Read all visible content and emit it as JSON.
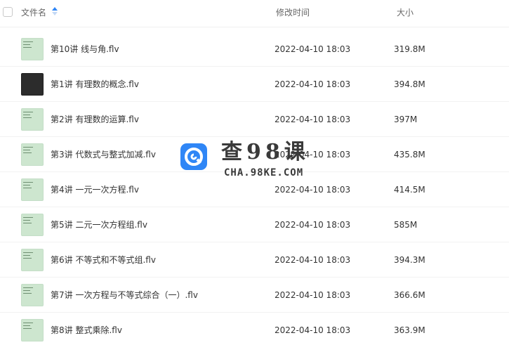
{
  "header": {
    "name_label": "文件名",
    "time_label": "修改时间",
    "size_label": "大小"
  },
  "files": [
    {
      "name": "第10讲 线与角.flv",
      "modified": "2022-04-10 18:03",
      "size": "319.8M",
      "thumb": "light"
    },
    {
      "name": "第1讲 有理数的概念.flv",
      "modified": "2022-04-10 18:03",
      "size": "394.8M",
      "thumb": "dark"
    },
    {
      "name": "第2讲 有理数的运算.flv",
      "modified": "2022-04-10 18:03",
      "size": "397M",
      "thumb": "light"
    },
    {
      "name": "第3讲 代数式与整式加减.flv",
      "modified": "2022-04-10 18:03",
      "size": "435.8M",
      "thumb": "light"
    },
    {
      "name": "第4讲 一元一次方程.flv",
      "modified": "2022-04-10 18:03",
      "size": "414.5M",
      "thumb": "light"
    },
    {
      "name": "第5讲 二元一次方程组.flv",
      "modified": "2022-04-10 18:03",
      "size": "585M",
      "thumb": "light"
    },
    {
      "name": "第6讲 不等式和不等式组.flv",
      "modified": "2022-04-10 18:03",
      "size": "394.3M",
      "thumb": "light"
    },
    {
      "name": "第7讲 一次方程与不等式综合（一）.flv",
      "modified": "2022-04-10 18:03",
      "size": "366.6M",
      "thumb": "light"
    },
    {
      "name": "第8讲 整式乘除.flv",
      "modified": "2022-04-10 18:03",
      "size": "363.9M",
      "thumb": "light"
    }
  ],
  "watermark": {
    "title": "查98课",
    "subtitle": "CHA.98KE.COM",
    "logo_color": "#2f86f6"
  },
  "icons": {
    "sort": "sort-asc-icon",
    "file_thumb": "video-thumbnail-icon"
  }
}
